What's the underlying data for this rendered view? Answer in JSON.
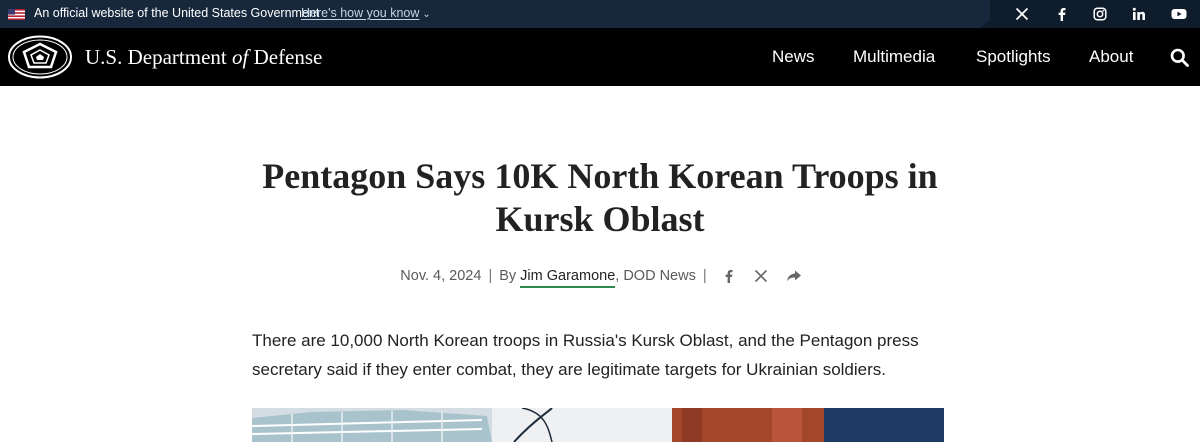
{
  "gov_banner": {
    "official_text": "An official website of the United States Government",
    "how_you_know": "Here's how you know",
    "social": [
      "x-icon",
      "facebook-icon",
      "instagram-icon",
      "linkedin-icon",
      "youtube-icon"
    ]
  },
  "header": {
    "site_name_pre": "U.S. Department ",
    "site_name_of": "of",
    "site_name_post": " Defense",
    "nav": [
      "News",
      "Multimedia",
      "Spotlights",
      "About"
    ]
  },
  "article": {
    "title": "Pentagon Says 10K North Korean Troops in Kursk Oblast",
    "date": "Nov. 4, 2024",
    "by": "By ",
    "author": "Jim Garamone",
    "outlet": ", DOD News",
    "lead": "There are 10,000 North Korean troops in Russia's Kursk Oblast, and the Pentagon press secretary said if they enter combat, they are legitimate targets for Ukrainian soldiers."
  },
  "colors": {
    "gov_banner_bg": "#17283d",
    "header_bg": "#000000",
    "author_underline": "#2a8a4a"
  }
}
